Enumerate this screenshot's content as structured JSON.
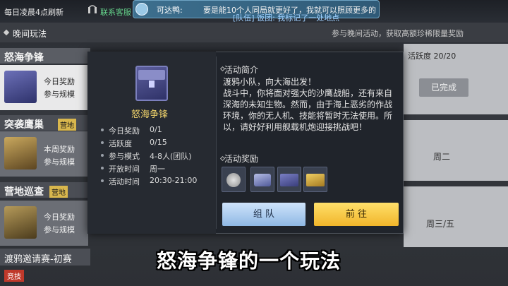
{
  "topbar": {
    "refresh_note": "每日凌晨4点刷新",
    "contact_cs": "联系客服"
  },
  "header": {
    "title": "晚间玩法",
    "desc": "参与晚间活动，获取高额珍稀限量奖励"
  },
  "message": {
    "sender": "可达鸭:",
    "text": "要是能10个人同局就更好了，我就可以照顾更多的",
    "team_msg": "[队伍] 饭团: 我标记了一处地点"
  },
  "activities": [
    {
      "name": "怒海争锋",
      "line1": "今日奖励",
      "line2": "参与规模"
    },
    {
      "name": "突袭鹰巢",
      "tag": "营地",
      "line1": "本周奖励",
      "line2": "参与规模"
    },
    {
      "name": "营地巡查",
      "tag": "营地",
      "line1": "今日奖励",
      "line2": "参与规模"
    },
    {
      "name": "渡鸦邀请赛-初赛",
      "tag": "竞技"
    }
  ],
  "right_panel": {
    "activity_points": "活跃度 20/20",
    "completed": "已完成",
    "day1": "周二",
    "day2": "周三/五"
  },
  "modal": {
    "title": "怒海争锋",
    "info": [
      {
        "k": "今日奖励",
        "v": "0/1"
      },
      {
        "k": "活跃度",
        "v": "0/15"
      },
      {
        "k": "参与模式",
        "v": "4-8人(团队)"
      },
      {
        "k": "开放时间",
        "v": "周一"
      },
      {
        "k": "活动时间",
        "v": "20:30-21:00"
      }
    ],
    "intro_title": "活动简介",
    "intro_lines": [
      "渡鸦小队，向大海出发！",
      "战斗中，你将面对强大的沙鹰战船，还有来自深海的未知生物。然而，由于海上恶劣的作战环境，你的无人机、技能将暂时无法使用。所以，请好好利用舰载机炮迎接挑战吧！"
    ],
    "reward_title": "活动奖励",
    "rewards": [
      "coin-icon",
      "vehicle-icon",
      "crate-icon",
      "gold-crate-icon"
    ],
    "team_button": "组 队",
    "go_button": "前 往"
  },
  "subtitle": "怒海争锋的一个玩法"
}
